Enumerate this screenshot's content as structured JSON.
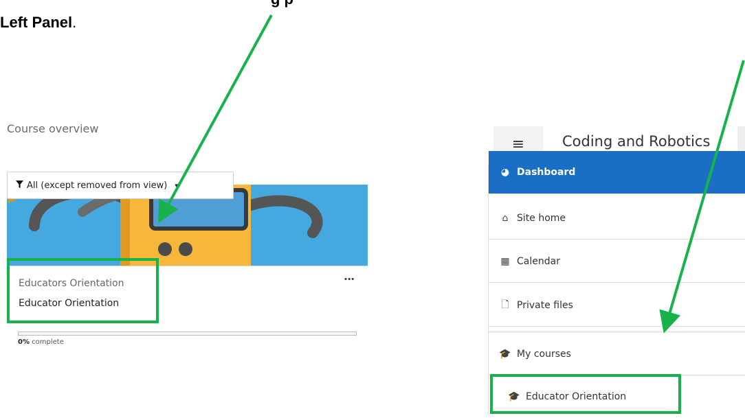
{
  "caption": {
    "left_bold": "Left Panel",
    "left_tail": ".",
    "top_fragment": "g p"
  },
  "course_overview": {
    "title": "Course overview",
    "filter": {
      "icon": "filter-icon",
      "label": "All (except removed from view)",
      "caret": "▾"
    },
    "card": {
      "category": "Educators Orientation",
      "name": "Educator Orientation",
      "more_label": "···",
      "progress": {
        "percent": 0,
        "value_text": "0%",
        "suffix": " complete"
      }
    }
  },
  "nav": {
    "toggle_icon": "hamburger-icon",
    "toggle_glyph": "≡",
    "site_title": "Coding and Robotics",
    "items": [
      {
        "label": "Dashboard",
        "icon": "dashboard-icon",
        "glyph": "◕",
        "active": true
      },
      {
        "label": "Site home",
        "icon": "home-icon",
        "glyph": "⌂"
      },
      {
        "label": "Calendar",
        "icon": "calendar-icon",
        "glyph": "▦"
      },
      {
        "label": "Private files",
        "icon": "file-icon",
        "glyph": "🗋"
      },
      {
        "label": "My courses",
        "icon": "graduation-cap-icon",
        "glyph": "🎓"
      },
      {
        "label": "Educator Orientation",
        "icon": "graduation-cap-icon",
        "glyph": "🎓"
      }
    ]
  },
  "colors": {
    "highlight": "#17b24a",
    "arrow": "#17b24a",
    "nav_active": "#1a6fc4",
    "card_image": "#45a9df",
    "robot_body": "#f7b73a"
  }
}
